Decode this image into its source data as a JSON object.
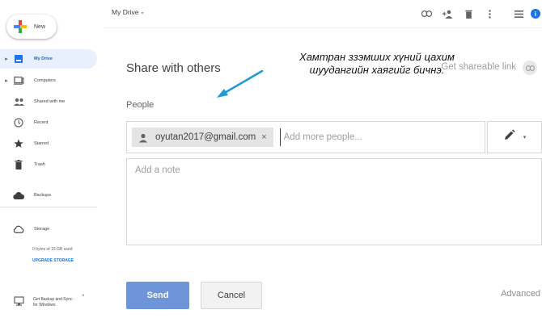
{
  "sidebar": {
    "new_label": "New",
    "items": [
      {
        "label": "My Drive",
        "icon": "drive-icon",
        "active": true
      },
      {
        "label": "Computers",
        "icon": "computer-icon"
      },
      {
        "label": "Shared with me",
        "icon": "people-icon"
      },
      {
        "label": "Recent",
        "icon": "clock-icon"
      },
      {
        "label": "Starred",
        "icon": "star-icon"
      },
      {
        "label": "Trash",
        "icon": "trash-icon"
      },
      {
        "label": "Backups",
        "icon": "cloud-icon"
      },
      {
        "label": "Storage",
        "icon": "cloud-outline-icon"
      }
    ],
    "storage_used": "0 bytes of 15 GB used",
    "upgrade_label": "UPGRADE STORAGE",
    "backup_promo": "Get Backup and Sync for Windows"
  },
  "topbar": {
    "breadcrumb": "My Drive",
    "icons": [
      "link-icon",
      "add-person-icon",
      "trash-icon",
      "more-vert-icon",
      "list-view-icon",
      "info-icon"
    ],
    "info_glyph": "i"
  },
  "dialog": {
    "title": "Share with others",
    "shareable_link_label": "Get shareable link",
    "people_label": "People",
    "chip_email": "oyutan2017@gmail.com",
    "chip_remove": "×",
    "people_placeholder": "Add more people...",
    "note_placeholder": "Add a note",
    "send_label": "Send",
    "cancel_label": "Cancel",
    "advanced_label": "Advanced"
  },
  "annotation": {
    "line1": "Хамтран ззэмших хүний цахим",
    "line2": "шуудангийн хаягийг бичнэ.",
    "color": "#1f9ad6"
  },
  "colors": {
    "accent": "#1a73e8",
    "send_button": "#6d95d8",
    "active_nav_bg": "#e8f0fe"
  }
}
